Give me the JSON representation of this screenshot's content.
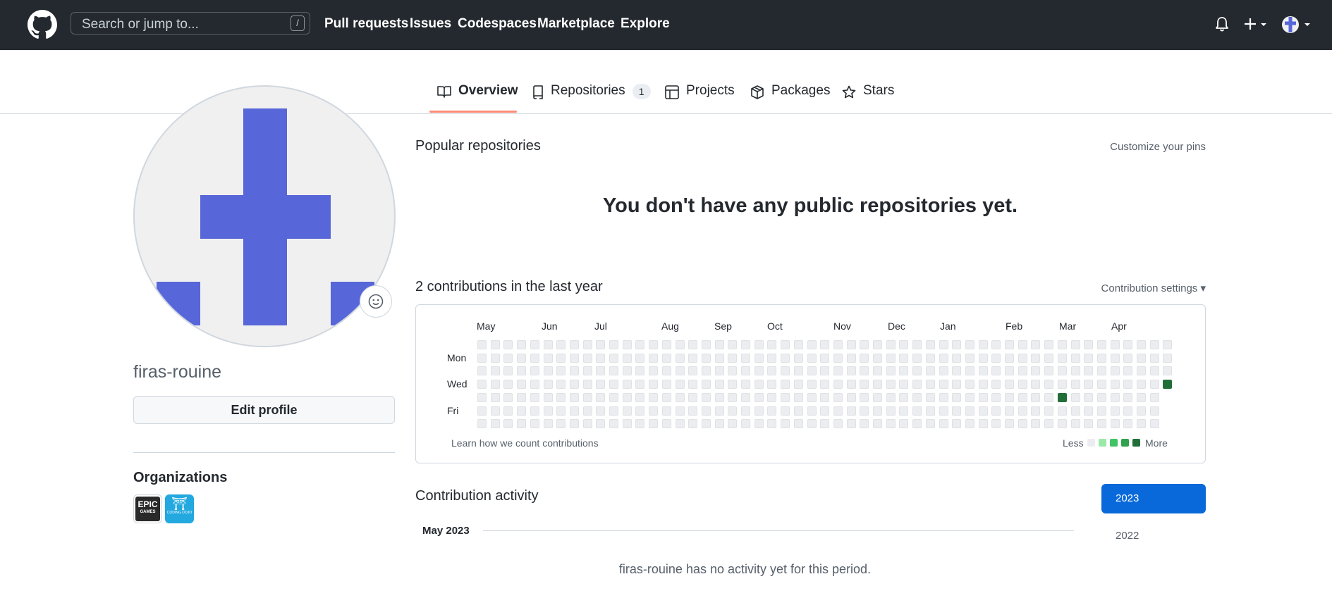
{
  "header": {
    "search_placeholder": "Search or jump to...",
    "search_shortcut": "/",
    "nav": [
      "Pull requests",
      "Issues",
      "Codespaces",
      "Marketplace",
      "Explore"
    ]
  },
  "tabs": [
    {
      "label": "Overview",
      "icon": "book-icon",
      "selected": true
    },
    {
      "label": "Repositories",
      "icon": "repo-icon",
      "count": "1"
    },
    {
      "label": "Projects",
      "icon": "table-icon"
    },
    {
      "label": "Packages",
      "icon": "package-icon"
    },
    {
      "label": "Stars",
      "icon": "star-icon"
    }
  ],
  "profile": {
    "username": "firas-rouine",
    "edit_label": "Edit profile",
    "orgs_title": "Organizations",
    "orgs": [
      {
        "name": "Epic Games",
        "line1": "EPIC",
        "line2": "GAMES",
        "color": "#2a2a2a"
      },
      {
        "name": "Coding Dojo",
        "line1": "⛩",
        "line2": "CODING DOJO",
        "color": "#23a8e0"
      }
    ],
    "avatar_color": "#5766d8"
  },
  "main": {
    "popular_title": "Popular repositories",
    "customize_pins": "Customize your pins",
    "empty_repos": "You don't have any public repositories yet.",
    "contrib_title": "2 contributions in the last year",
    "contrib_settings": "Contribution settings ▾",
    "months": [
      "May",
      "Jun",
      "Jul",
      "Aug",
      "Sep",
      "Oct",
      "Nov",
      "Dec",
      "Jan",
      "Feb",
      "Mar",
      "Apr"
    ],
    "days": [
      "Mon",
      "Wed",
      "Fri"
    ],
    "learn_link": "Learn how we count contributions",
    "legend_less": "Less",
    "legend_more": "More",
    "legend_colors": [
      "#ebedf0",
      "#9be9a8",
      "#40c463",
      "#30a14e",
      "#216e39"
    ],
    "contributions": [
      {
        "week": 44,
        "day": 4,
        "color": "#216e39"
      },
      {
        "week": 52,
        "day": 3,
        "color": "#216e39"
      }
    ],
    "activity_title": "Contribution activity",
    "years": [
      "2023",
      "2022"
    ],
    "activity_month": "May 2023",
    "no_activity": "firas-rouine has no activity yet for this period."
  }
}
